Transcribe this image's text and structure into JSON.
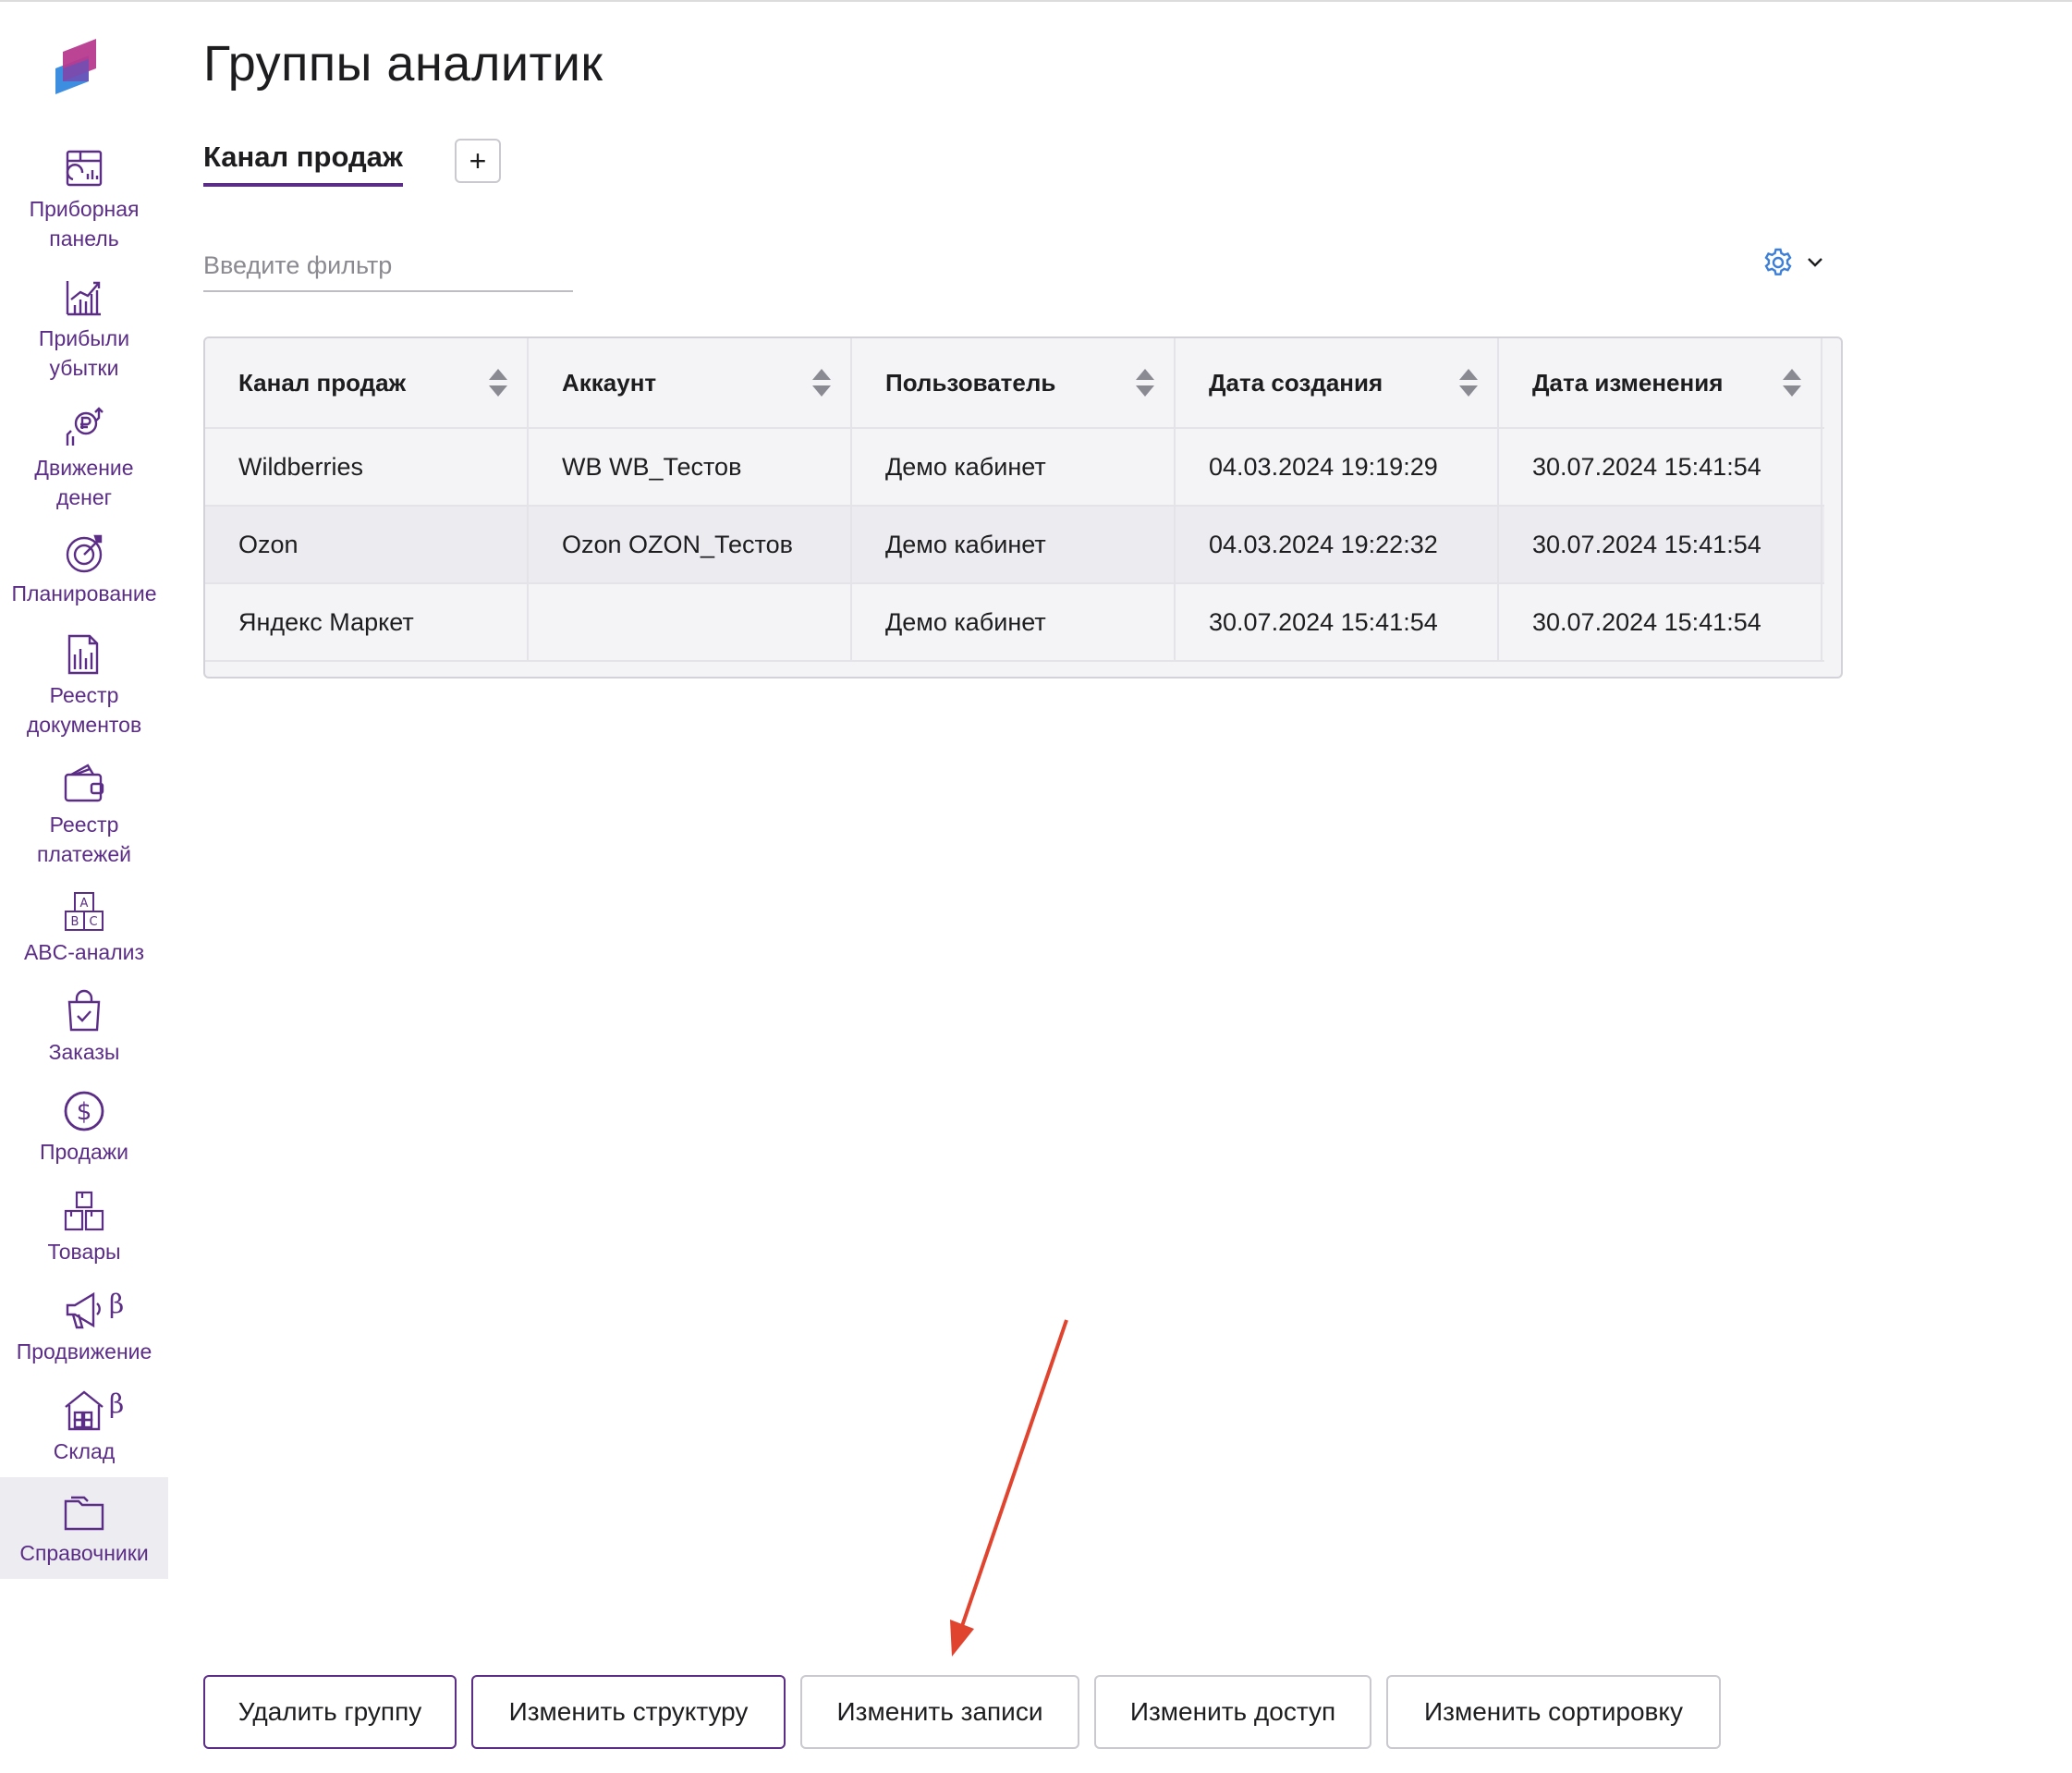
{
  "page": {
    "title": "Группы аналитик"
  },
  "sidebar": {
    "items": [
      {
        "label": "Приборная\nпанель",
        "icon": "dashboard-icon"
      },
      {
        "label": "Прибыли\nубытки",
        "icon": "profit-chart-icon"
      },
      {
        "label": "Движение\nденег",
        "icon": "money-flow-icon"
      },
      {
        "label": "Планирование",
        "icon": "target-icon"
      },
      {
        "label": "Реестр\nдокументов",
        "icon": "document-registry-icon"
      },
      {
        "label": "Реестр\nплатежей",
        "icon": "wallet-icon"
      },
      {
        "label": "ABC-анализ",
        "icon": "abc-blocks-icon"
      },
      {
        "label": "Заказы",
        "icon": "shopping-bag-icon"
      },
      {
        "label": "Продажи",
        "icon": "dollar-circle-icon"
      },
      {
        "label": "Товары",
        "icon": "boxes-icon"
      },
      {
        "label": "Продвижение",
        "icon": "megaphone-icon",
        "badge": "β"
      },
      {
        "label": "Склад",
        "icon": "warehouse-icon",
        "badge": "β"
      },
      {
        "label": "Справочники",
        "icon": "folder-icon",
        "active": true
      }
    ]
  },
  "tabs": {
    "active_label": "Канал продаж",
    "add_label": "+"
  },
  "filter": {
    "placeholder": "Введите фильтр"
  },
  "table": {
    "columns": [
      "Канал продаж",
      "Аккаунт",
      "Пользователь",
      "Дата создания",
      "Дата изменения"
    ],
    "rows": [
      [
        "Wildberries",
        "WB WB_Тестов",
        "Демо кабинет",
        "04.03.2024 19:19:29",
        "30.07.2024 15:41:54"
      ],
      [
        "Ozon",
        "Ozon OZON_Тестов",
        "Демо кабинет",
        "04.03.2024 19:22:32",
        "30.07.2024 15:41:54"
      ],
      [
        "Яндекс Маркет",
        "",
        "Демо кабинет",
        "30.07.2024 15:41:54",
        "30.07.2024 15:41:54"
      ]
    ]
  },
  "actions": {
    "delete_group": "Удалить группу",
    "edit_structure": "Изменить структуру",
    "edit_records": "Изменить записи",
    "edit_access": "Изменить доступ",
    "edit_sorting": "Изменить сортировку"
  },
  "colors": {
    "accent": "#5b2d86",
    "annotation_arrow": "#e0442f",
    "gear": "#3d7fd6"
  }
}
